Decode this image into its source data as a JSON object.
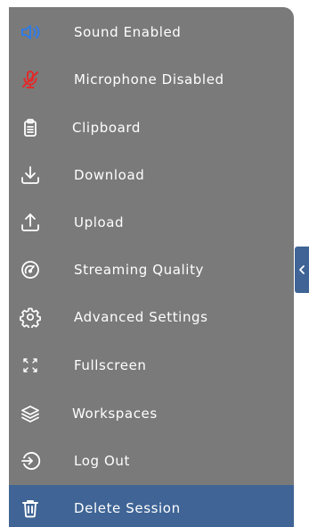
{
  "menu": {
    "items": [
      {
        "label": "Sound Enabled",
        "icon": "speaker-on-icon"
      },
      {
        "label": "Microphone Disabled",
        "icon": "microphone-off-icon"
      },
      {
        "label": "Clipboard",
        "icon": "clipboard-icon"
      },
      {
        "label": "Download",
        "icon": "download-icon"
      },
      {
        "label": "Upload",
        "icon": "upload-icon"
      },
      {
        "label": "Streaming Quality",
        "icon": "gauge-icon"
      },
      {
        "label": "Advanced Settings",
        "icon": "gear-icon"
      },
      {
        "label": "Fullscreen",
        "icon": "fullscreen-icon"
      },
      {
        "label": "Workspaces",
        "icon": "layers-icon"
      },
      {
        "label": "Log Out",
        "icon": "logout-icon"
      },
      {
        "label": "Delete Session",
        "icon": "trash-icon",
        "active": true
      }
    ]
  },
  "colors": {
    "panel": "#7a7a7a",
    "accent": "#3f6495",
    "speaker_icon": "#2f7be5",
    "microphone_off_icon": "#e12b2b",
    "text": "#ffffff"
  },
  "side_tab": {
    "icon": "chevron-left-icon"
  }
}
